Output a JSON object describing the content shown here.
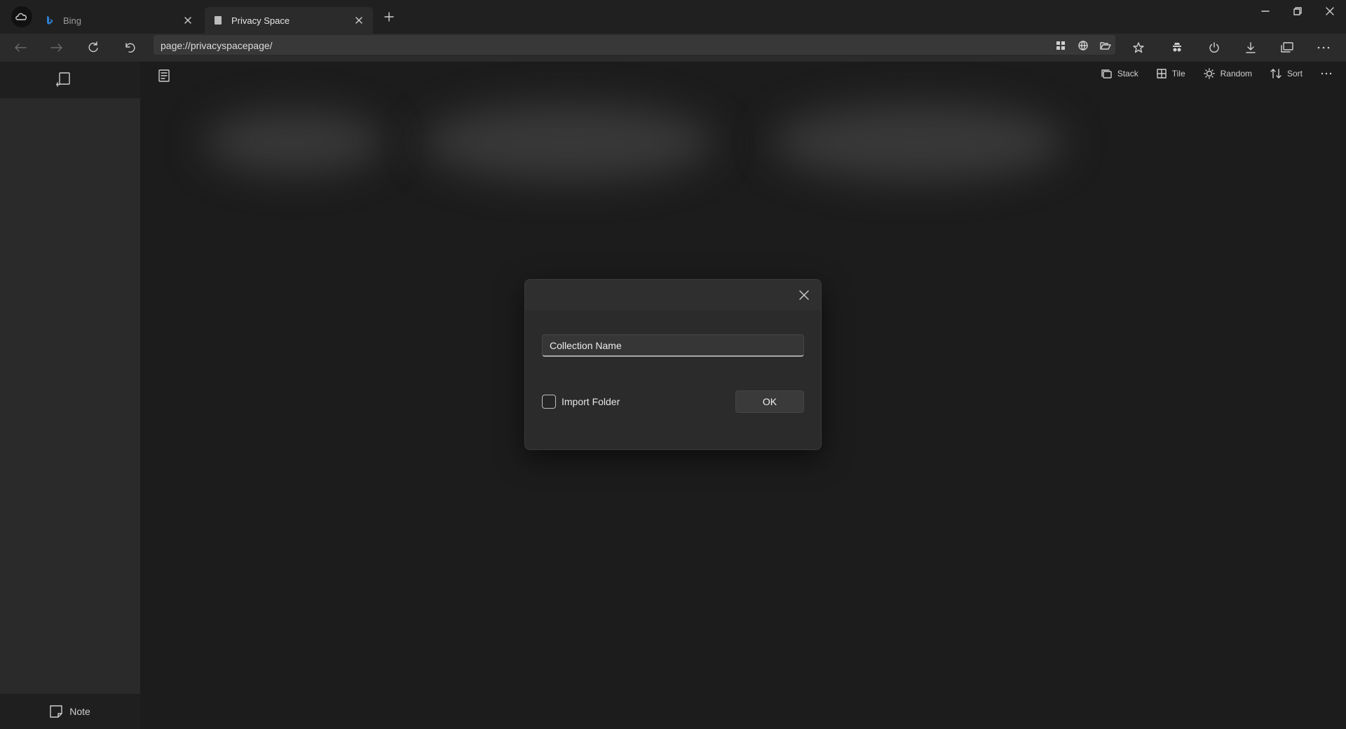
{
  "tabs": [
    {
      "title": "Bing",
      "active": false,
      "icon": "bing-icon"
    },
    {
      "title": "Privacy Space",
      "active": true,
      "icon": "page-icon"
    }
  ],
  "address": {
    "url": "page://privacyspacepage/"
  },
  "toolbar": {
    "stack_label": "Stack",
    "tile_label": "Tile",
    "random_label": "Random",
    "sort_label": "Sort"
  },
  "sidebar": {
    "note_label": "Note"
  },
  "dialog": {
    "input_value": "Collection Name",
    "checkbox_label": "Import Folder",
    "ok_label": "OK"
  },
  "colors": {
    "background": "#1c1c1c",
    "titlebar": "#202020",
    "navbar": "#2b2b2b",
    "dialog": "#2b2b2b",
    "accent_bing": "#2f7fd3"
  }
}
